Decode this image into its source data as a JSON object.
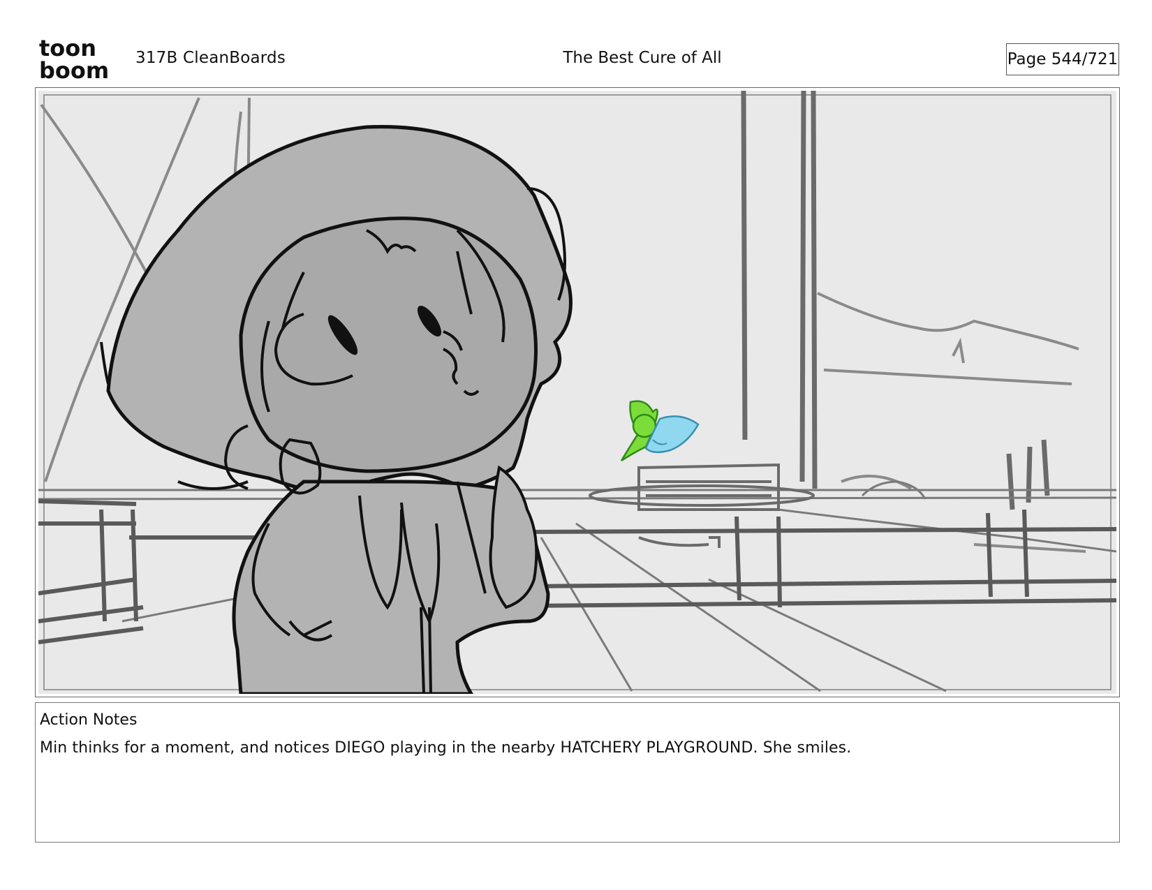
{
  "header": {
    "logo": {
      "line1": "toon",
      "line2": "boom"
    },
    "project": "317B  CleanBoards",
    "title": "The Best Cure of All",
    "page": "Page 544/721"
  },
  "panel": {
    "background": "#e8e8e8",
    "character_fill": "#b3b3b3",
    "accent_green": "#7cdc3a",
    "accent_blue": "#8fd8ef"
  },
  "notes": {
    "heading": "Action Notes",
    "body": "Min thinks for a moment, and notices DIEGO playing in the nearby HATCHERY PLAYGROUND. She smiles."
  }
}
